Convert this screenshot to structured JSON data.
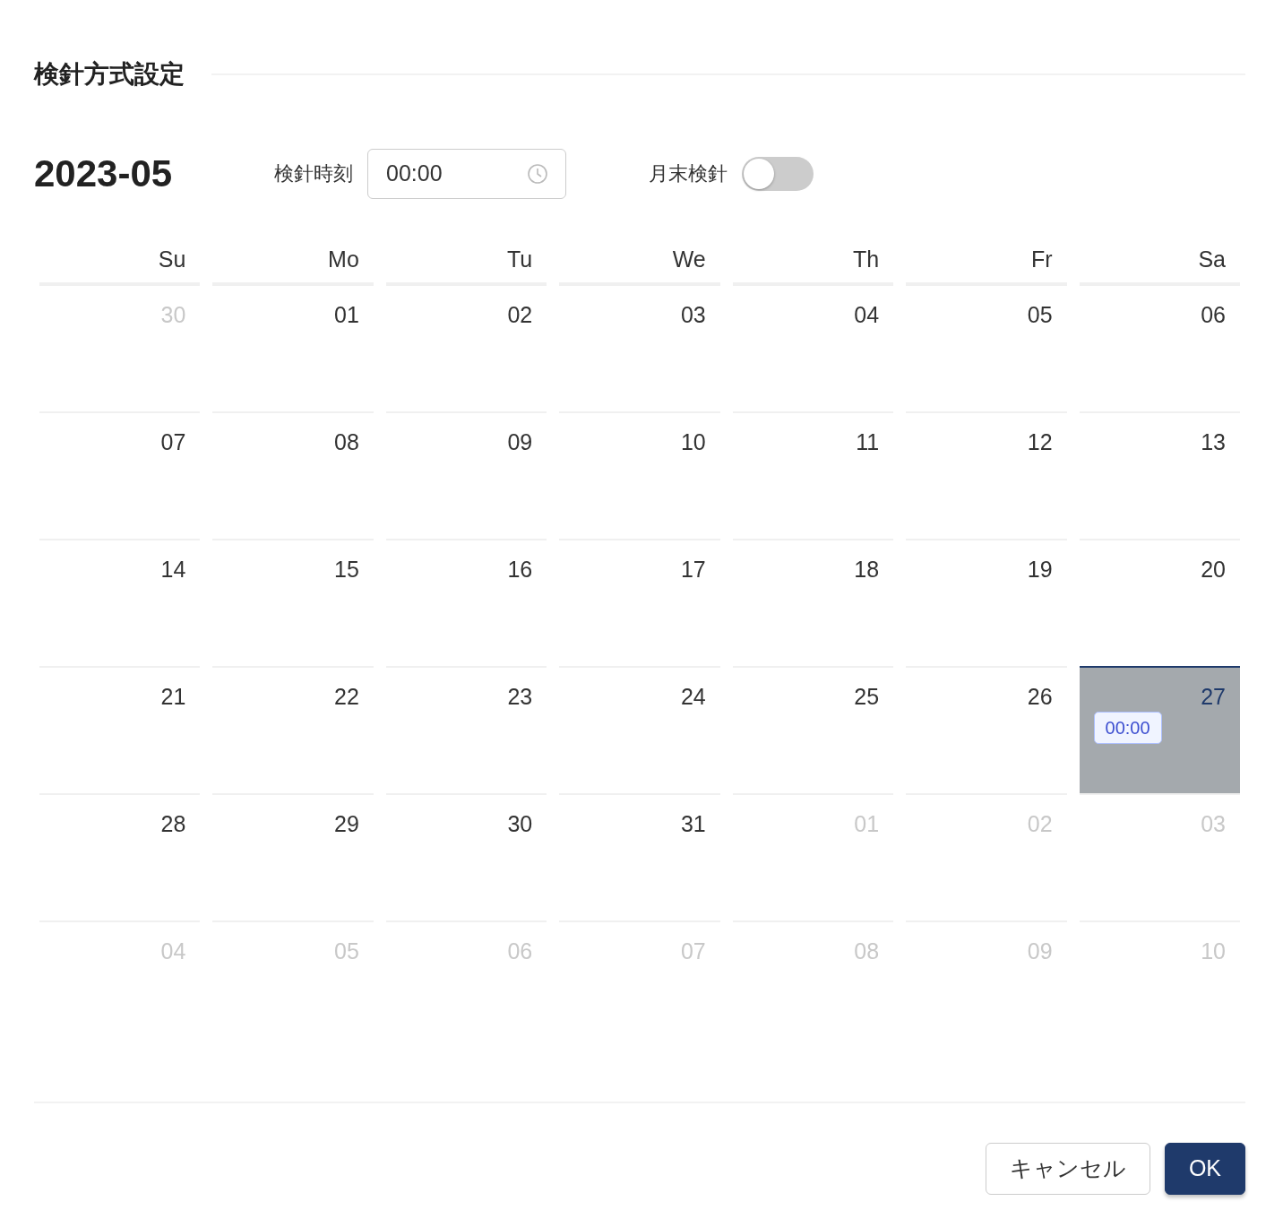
{
  "dialog": {
    "title": "検針方式設定"
  },
  "month": "2023-05",
  "time_field": {
    "label": "検針時刻",
    "value": "00:00"
  },
  "month_end": {
    "label": "月末検針",
    "on": false
  },
  "weekdays": [
    "Su",
    "Mo",
    "Tu",
    "We",
    "Th",
    "Fr",
    "Sa"
  ],
  "days": [
    {
      "day": "30",
      "outside": true,
      "selected": false
    },
    {
      "day": "01",
      "outside": false,
      "selected": false
    },
    {
      "day": "02",
      "outside": false,
      "selected": false
    },
    {
      "day": "03",
      "outside": false,
      "selected": false
    },
    {
      "day": "04",
      "outside": false,
      "selected": false
    },
    {
      "day": "05",
      "outside": false,
      "selected": false
    },
    {
      "day": "06",
      "outside": false,
      "selected": false
    },
    {
      "day": "07",
      "outside": false,
      "selected": false
    },
    {
      "day": "08",
      "outside": false,
      "selected": false
    },
    {
      "day": "09",
      "outside": false,
      "selected": false
    },
    {
      "day": "10",
      "outside": false,
      "selected": false
    },
    {
      "day": "11",
      "outside": false,
      "selected": false
    },
    {
      "day": "12",
      "outside": false,
      "selected": false
    },
    {
      "day": "13",
      "outside": false,
      "selected": false
    },
    {
      "day": "14",
      "outside": false,
      "selected": false
    },
    {
      "day": "15",
      "outside": false,
      "selected": false
    },
    {
      "day": "16",
      "outside": false,
      "selected": false
    },
    {
      "day": "17",
      "outside": false,
      "selected": false
    },
    {
      "day": "18",
      "outside": false,
      "selected": false
    },
    {
      "day": "19",
      "outside": false,
      "selected": false
    },
    {
      "day": "20",
      "outside": false,
      "selected": false
    },
    {
      "day": "21",
      "outside": false,
      "selected": false
    },
    {
      "day": "22",
      "outside": false,
      "selected": false
    },
    {
      "day": "23",
      "outside": false,
      "selected": false
    },
    {
      "day": "24",
      "outside": false,
      "selected": false
    },
    {
      "day": "25",
      "outside": false,
      "selected": false
    },
    {
      "day": "26",
      "outside": false,
      "selected": false
    },
    {
      "day": "27",
      "outside": false,
      "selected": true,
      "event": "00:00"
    },
    {
      "day": "28",
      "outside": false,
      "selected": false
    },
    {
      "day": "29",
      "outside": false,
      "selected": false
    },
    {
      "day": "30",
      "outside": false,
      "selected": false
    },
    {
      "day": "31",
      "outside": false,
      "selected": false
    },
    {
      "day": "01",
      "outside": true,
      "selected": false
    },
    {
      "day": "02",
      "outside": true,
      "selected": false
    },
    {
      "day": "03",
      "outside": true,
      "selected": false
    },
    {
      "day": "04",
      "outside": true,
      "selected": false
    },
    {
      "day": "05",
      "outside": true,
      "selected": false
    },
    {
      "day": "06",
      "outside": true,
      "selected": false
    },
    {
      "day": "07",
      "outside": true,
      "selected": false
    },
    {
      "day": "08",
      "outside": true,
      "selected": false
    },
    {
      "day": "09",
      "outside": true,
      "selected": false
    },
    {
      "day": "10",
      "outside": true,
      "selected": false
    }
  ],
  "buttons": [
    {
      "label": "キャンセル",
      "kind": "secondary"
    },
    {
      "label": "OK",
      "kind": "primary"
    }
  ]
}
